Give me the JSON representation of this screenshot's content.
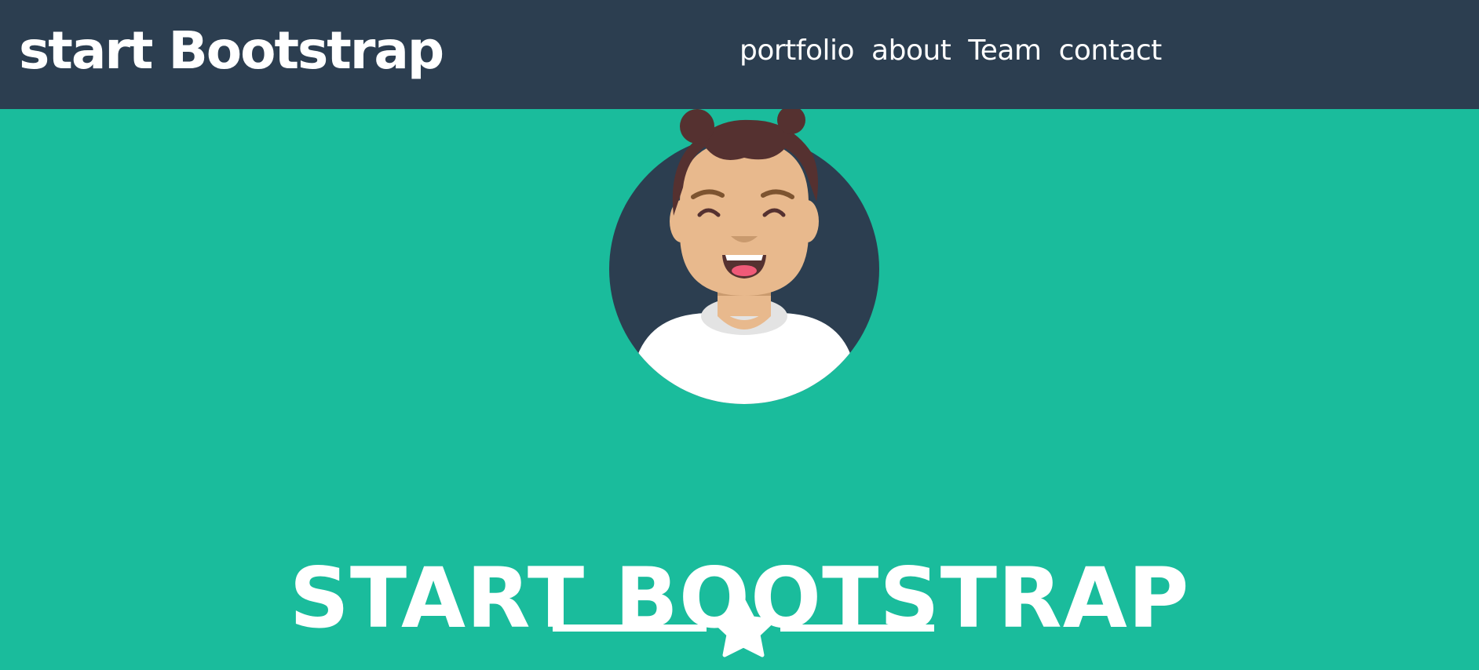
{
  "navbar": {
    "brand": "start Bootstrap",
    "links": [
      "portfolio",
      "about",
      "Team",
      "contact"
    ]
  },
  "hero": {
    "title": "START BOOTSTRAP",
    "avatar_icon": "avatar-icon",
    "divider_icon": "star-icon"
  },
  "colors": {
    "navbar_bg": "#2c3e50",
    "page_bg": "#1abc9c",
    "text": "#ffffff"
  }
}
